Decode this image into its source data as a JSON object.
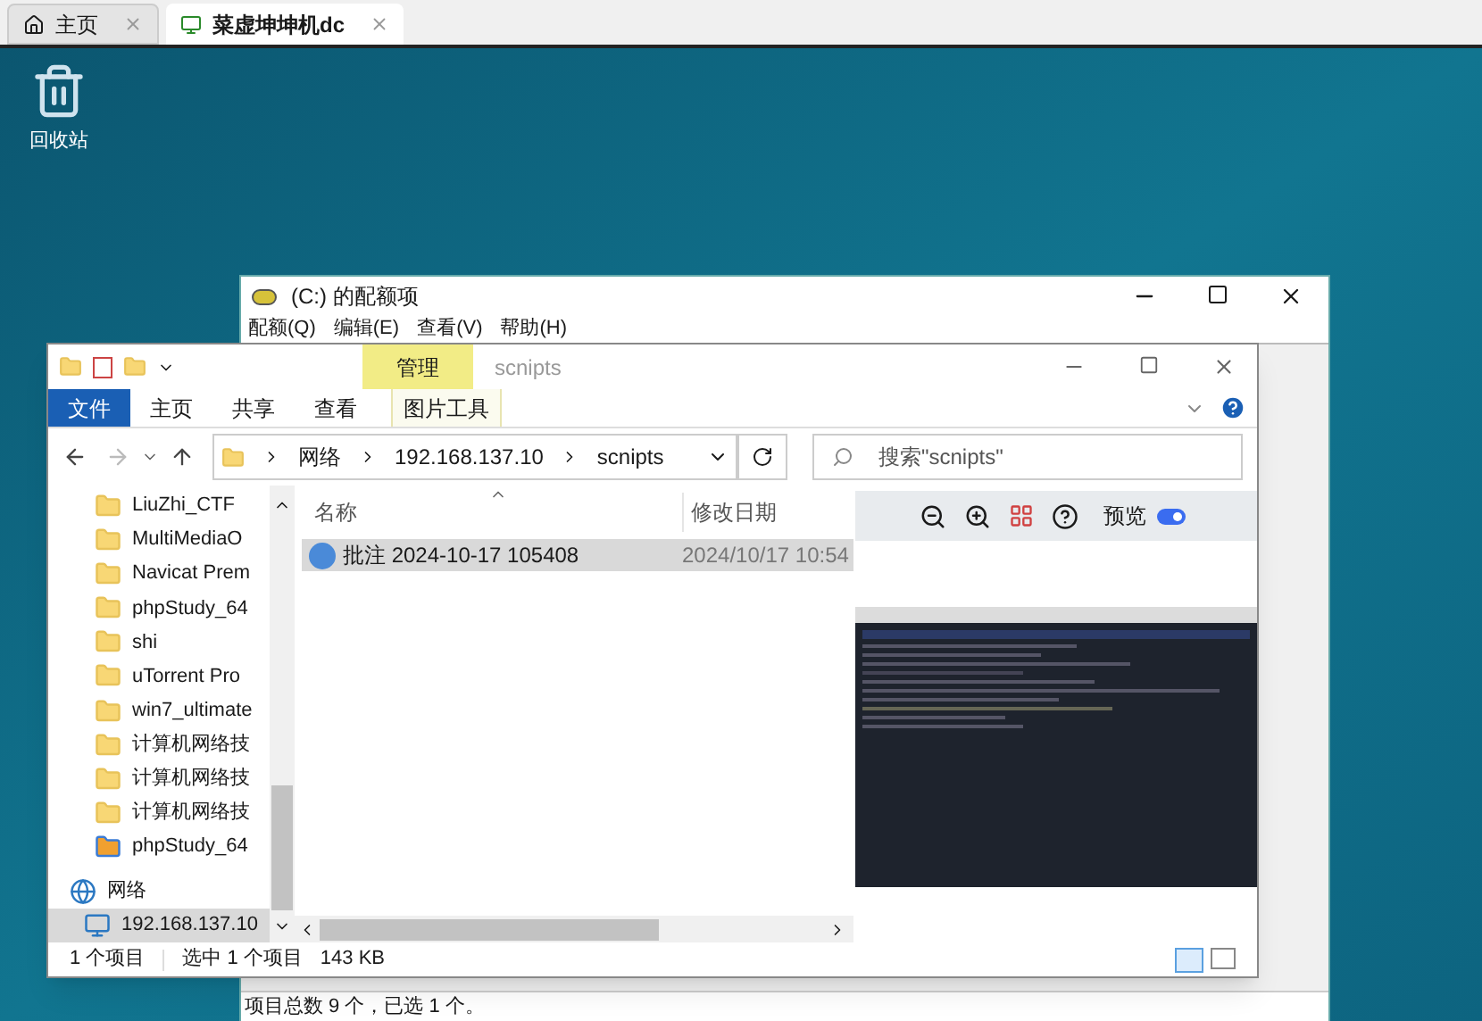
{
  "browser_tabs": [
    {
      "label": "主页",
      "selected": false,
      "kind": "home"
    },
    {
      "label": "菜虚坤坤机dc",
      "selected": true,
      "kind": "vm"
    }
  ],
  "desktop_icons": [
    {
      "label": "回收站"
    }
  ],
  "back_window": {
    "title": "(C:) 的配额项",
    "menu": [
      "配额(Q)",
      "编辑(E)",
      "查看(V)",
      "帮助(H)"
    ],
    "status": "项目总数 9 个，已选 1 个。"
  },
  "explorer": {
    "context_tab": "管理",
    "title": "scnipts",
    "ribbon_tabs": [
      {
        "label": "文件",
        "kind": "file"
      },
      {
        "label": "主页",
        "kind": "tab"
      },
      {
        "label": "共享",
        "kind": "tab"
      },
      {
        "label": "查看",
        "kind": "tab"
      },
      {
        "label": "图片工具",
        "kind": "context"
      }
    ],
    "address": [
      "网络",
      "192.168.137.10",
      "scnipts"
    ],
    "search": {
      "placeholder": "搜索\"scnipts\""
    },
    "nav_items": [
      {
        "label": "LiuZhi_CTF",
        "kind": "folder",
        "selected": false
      },
      {
        "label": "MultiMediaO",
        "kind": "folder",
        "selected": false
      },
      {
        "label": "Navicat Prem",
        "kind": "folder",
        "selected": false
      },
      {
        "label": "phpStudy_64",
        "kind": "folder",
        "selected": false
      },
      {
        "label": "shi",
        "kind": "folder",
        "selected": false
      },
      {
        "label": "uTorrent Pro",
        "kind": "folder",
        "selected": false
      },
      {
        "label": "win7_ultimate",
        "kind": "folder",
        "selected": false
      },
      {
        "label": "计算机网络技",
        "kind": "folder",
        "selected": false
      },
      {
        "label": "计算机网络技",
        "kind": "folder",
        "selected": false
      },
      {
        "label": "计算机网络技",
        "kind": "folder",
        "selected": false
      },
      {
        "label": "phpStudy_64",
        "kind": "app",
        "selected": false
      },
      {
        "label": "网络",
        "kind": "network",
        "selected": false,
        "children": [
          {
            "label": "192.168.137.10",
            "kind": "computer",
            "selected": true
          }
        ]
      }
    ],
    "columns": [
      "名称",
      "修改日期"
    ],
    "files": [
      {
        "name": "批注 2024-10-17 105408",
        "date": "2024/10/17 10:54",
        "selected": true
      }
    ],
    "preview": {
      "label": "预览",
      "on": true
    },
    "status": [
      "1 个项目",
      "选中 1 个项目",
      "143 KB"
    ]
  }
}
